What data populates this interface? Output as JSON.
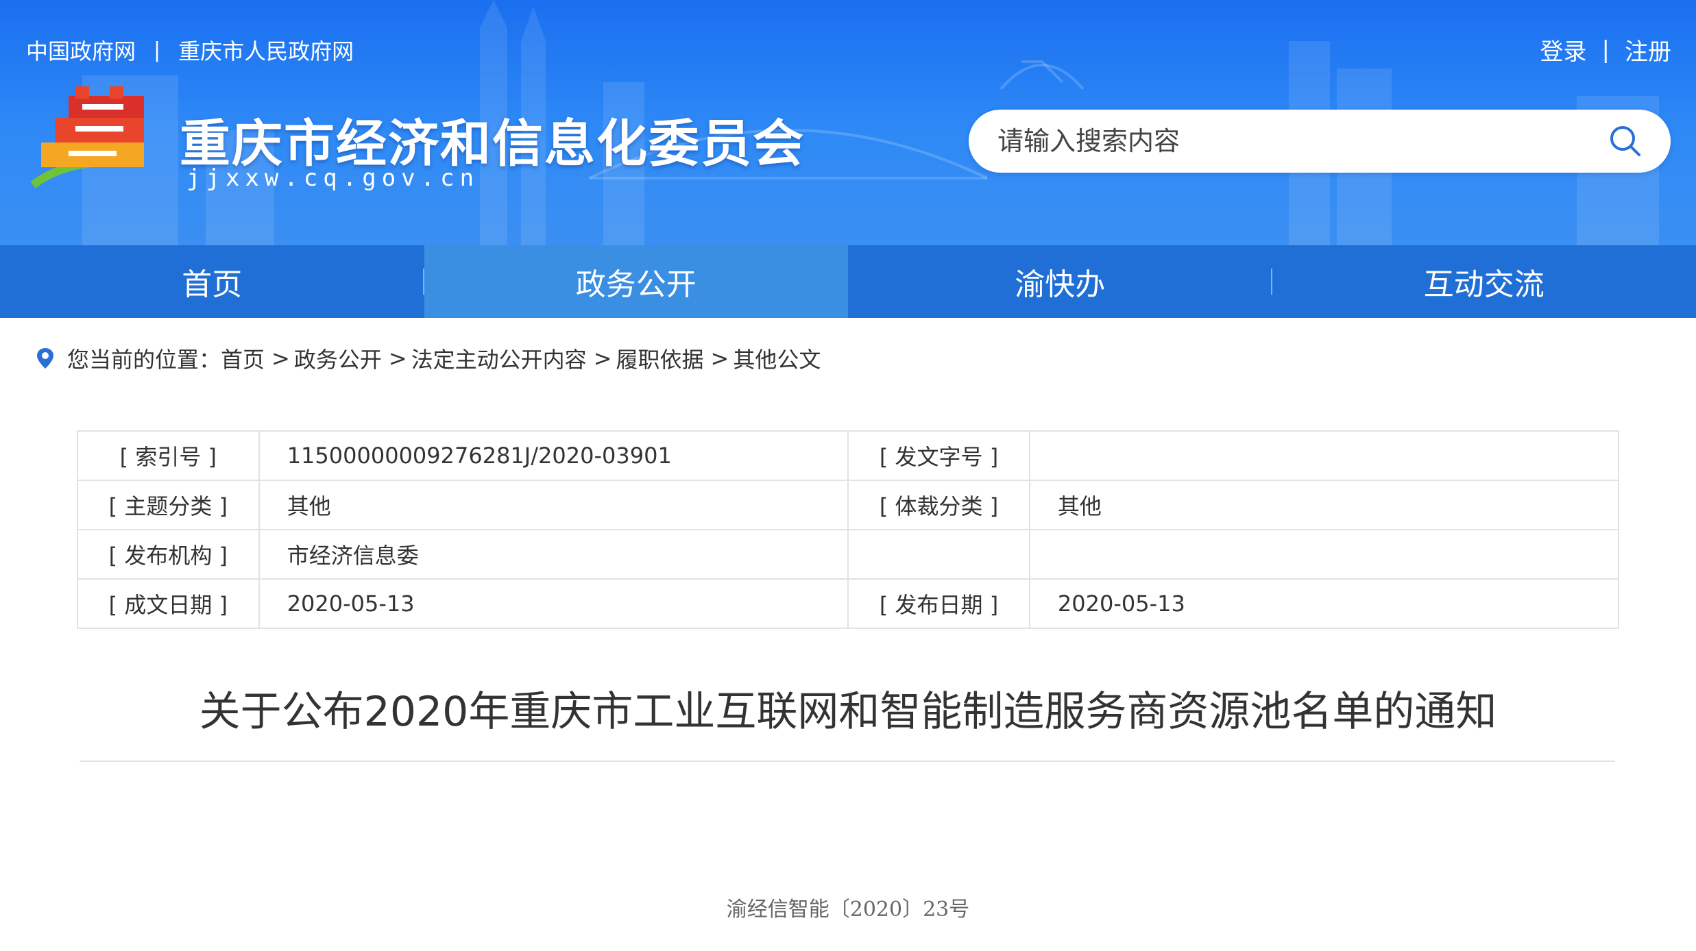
{
  "header": {
    "top_links": [
      "中国政府网",
      "重庆市人民政府网"
    ],
    "user_links": {
      "login": "登录",
      "register": "注册"
    },
    "separator": "|",
    "site_title": "重庆市经济和信息化委员会",
    "site_domain": "jjxxw.cq.gov.cn",
    "search_placeholder": "请输入搜索内容"
  },
  "nav": {
    "items": [
      "首页",
      "政务公开",
      "渝快办",
      "互动交流"
    ],
    "active": "政务公开"
  },
  "breadcrumb": {
    "prefix": "您当前的位置：",
    "items": [
      "首页",
      "政务公开",
      "法定主动公开内容",
      "履职依据",
      "其他公文"
    ],
    "separator": ">"
  },
  "meta": {
    "rows": [
      {
        "k1": "[ 索引号 ]",
        "v1": "11500000009276281J/2020-03901",
        "k2": "[ 发文字号 ]",
        "v2": ""
      },
      {
        "k1": "[ 主题分类 ]",
        "v1": "其他",
        "k2": "[ 体裁分类 ]",
        "v2": "其他"
      },
      {
        "k1": "[ 发布机构 ]",
        "v1": "市经济信息委",
        "k2": "",
        "v2": ""
      },
      {
        "k1": "[ 成文日期 ]",
        "v1": "2020-05-13",
        "k2": "[ 发布日期 ]",
        "v2": "2020-05-13"
      }
    ]
  },
  "article": {
    "title": "关于公布2020年重庆市工业互联网和智能制造服务商资源池名单的通知",
    "doc_number": "渝经信智能〔2020〕23号"
  },
  "colors": {
    "header_blue": "#1a6ff0",
    "nav_blue": "#1f6fd6",
    "nav_active": "#3b8fe3",
    "text": "#333333"
  }
}
